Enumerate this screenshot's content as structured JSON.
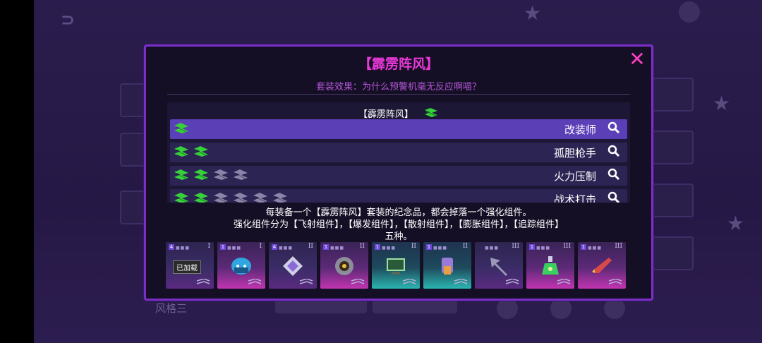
{
  "modal": {
    "title": "【霹雳阵风】",
    "subtitle": "套装效果：为什么预警机毫无反应啊喵？",
    "close_symbol": "✕"
  },
  "set_list": {
    "header": "【霹雳阵风】",
    "rows": [
      {
        "label": "改装师",
        "icon_count": 1,
        "active": 1,
        "selected": true
      },
      {
        "label": "孤胆枪手",
        "icon_count": 2,
        "active": 2,
        "selected": false
      },
      {
        "label": "火力压制",
        "icon_count": 4,
        "active": 2,
        "selected": false
      },
      {
        "label": "战术打击",
        "icon_count": 6,
        "active": 2,
        "selected": false
      }
    ]
  },
  "description": {
    "line1": "每装备一个【霹雳阵风】套装的纪念品，都会掉落一个强化组件。",
    "line2": "强化组件分为【飞射组件】，【爆发组件】，【散射组件】，【膨胀组件】，【追踪组件】",
    "line3": "五种。"
  },
  "cards": [
    {
      "tier": "I",
      "slot": "4",
      "style": "plain",
      "item": "loaded-badge-icon",
      "loaded_label": "已加载"
    },
    {
      "tier": "I",
      "slot": "1",
      "style": "pink",
      "item": "helmet-icon"
    },
    {
      "tier": "II",
      "slot": "4",
      "style": "plain",
      "item": "diamond-icon"
    },
    {
      "tier": "II",
      "slot": "1",
      "style": "pink",
      "item": "shield-icon"
    },
    {
      "tier": "II",
      "slot": "1",
      "style": "teal",
      "item": "monitor-icon"
    },
    {
      "tier": "II",
      "slot": "1",
      "style": "teal",
      "item": "bottle-icon"
    },
    {
      "tier": "III",
      "slot": "",
      "style": "plain",
      "item": "arrow-icon"
    },
    {
      "tier": "III",
      "slot": "1",
      "style": "pink",
      "item": "potion-icon"
    },
    {
      "tier": "III",
      "slot": "1",
      "style": "pink",
      "item": "rocket-icon"
    }
  ],
  "background": {
    "bottom_label": "风格三"
  },
  "colors": {
    "title": "#e838d6",
    "subtitle": "#b457d8",
    "frame": "#7a2fc9",
    "selected_row": "#5b3fb7",
    "set_icon_active": "#36d13a",
    "set_icon_inactive": "#8a84a8"
  }
}
